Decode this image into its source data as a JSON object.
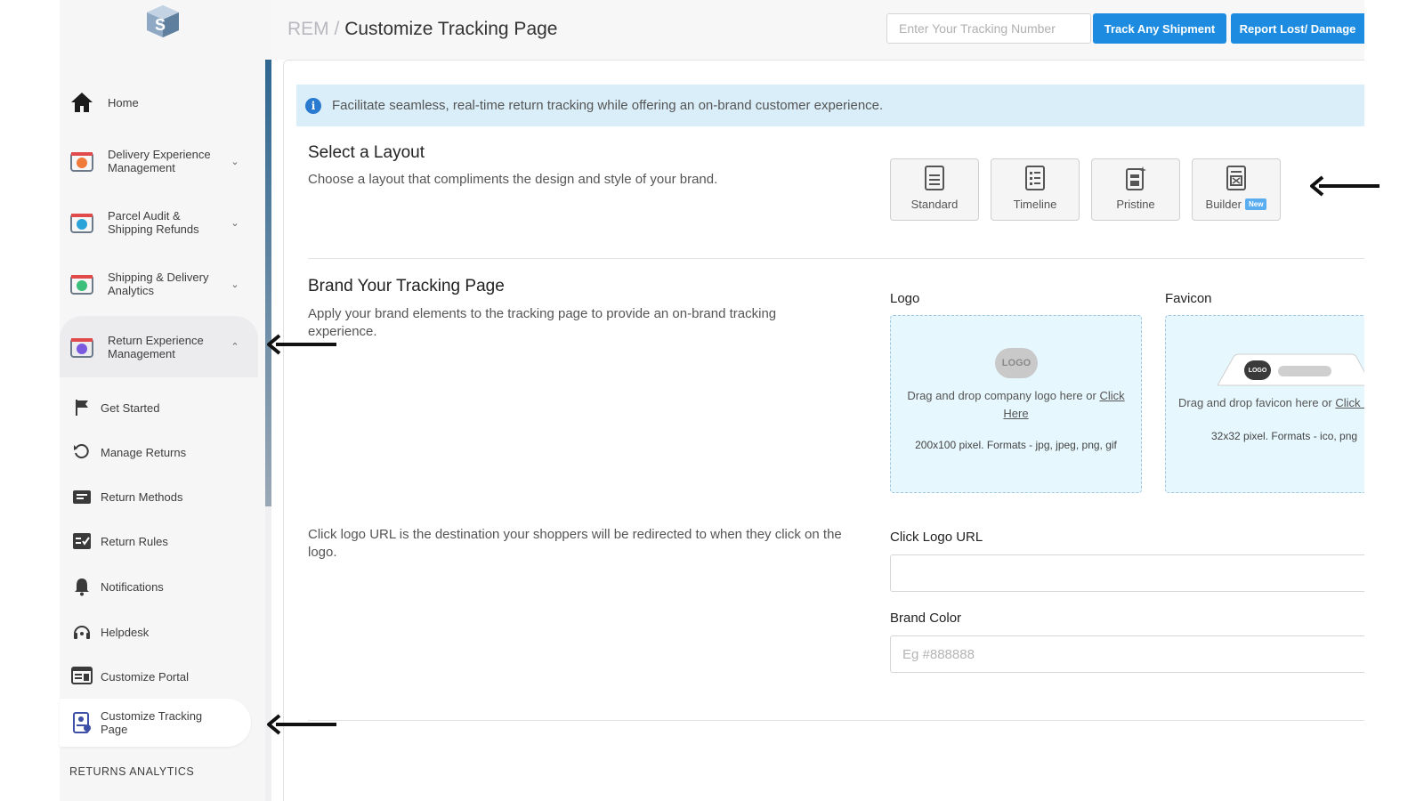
{
  "sidebar": {
    "items": [
      {
        "label": "Home",
        "icon": "home-icon"
      },
      {
        "label": "Delivery Experience Management",
        "icon": "delivery-experience-icon"
      },
      {
        "label": "Parcel Audit & Shipping Refunds",
        "icon": "parcel-audit-icon"
      },
      {
        "label": "Shipping & Delivery Analytics",
        "icon": "shipping-analytics-icon"
      },
      {
        "label": "Return Experience Management",
        "icon": "return-experience-icon"
      }
    ],
    "sub_items": [
      {
        "label": "Get Started",
        "icon": "flag-icon"
      },
      {
        "label": "Manage Returns",
        "icon": "undo-icon"
      },
      {
        "label": "Return Methods",
        "icon": "return-methods-icon"
      },
      {
        "label": "Return Rules",
        "icon": "checklist-icon"
      },
      {
        "label": "Notifications",
        "icon": "bell-icon"
      },
      {
        "label": "Helpdesk",
        "icon": "headset-icon"
      },
      {
        "label": "Customize Portal",
        "icon": "portal-icon"
      },
      {
        "label": "Customize Tracking Page",
        "icon": "tracking-page-icon"
      }
    ],
    "section_label": "RETURNS ANALYTICS"
  },
  "header": {
    "crumb_parent": "REM",
    "crumb_sep": "/",
    "title": "Customize Tracking Page",
    "tracking_placeholder": "Enter Your Tracking Number",
    "track_button": "Track Any Shipment",
    "report_button": "Report Lost/ Damage"
  },
  "info_banner": "Facilitate seamless, real-time return tracking while offering an on-brand customer experience.",
  "layout_section": {
    "title": "Select a Layout",
    "subtitle": "Choose a layout that compliments the design and style of your brand.",
    "options": [
      {
        "label": "Standard"
      },
      {
        "label": "Timeline"
      },
      {
        "label": "Pristine"
      },
      {
        "label": "Builder",
        "badge": "New"
      }
    ]
  },
  "brand_section": {
    "title": "Brand Your Tracking Page",
    "subtitle": "Apply your brand elements to the tracking page to provide an on-brand tracking experience.",
    "logo": {
      "label": "Logo",
      "placeholder_text": "LOGO",
      "drop_text": "Drag and drop company logo here or",
      "link_text": "Click Here",
      "formats": "200x100 pixel. Formats - jpg, jpeg, png, gif"
    },
    "favicon": {
      "label": "Favicon",
      "placeholder_text": "LOGO",
      "drop_text": "Drag and drop favicon here or",
      "link_text": "Click Here",
      "formats": "32x32 pixel. Formats - ico, png"
    },
    "click_logo_desc": "Click logo URL is the destination your shoppers will be redirected to when they click on the logo.",
    "click_logo_label": "Click Logo URL",
    "click_logo_value": "",
    "brand_color_label": "Brand Color",
    "brand_color_placeholder": "Eg #888888"
  },
  "colors": {
    "primary": "#1d8ce0",
    "info_bg": "#d9eef9",
    "dropzone_bg": "#e6f7fd"
  }
}
